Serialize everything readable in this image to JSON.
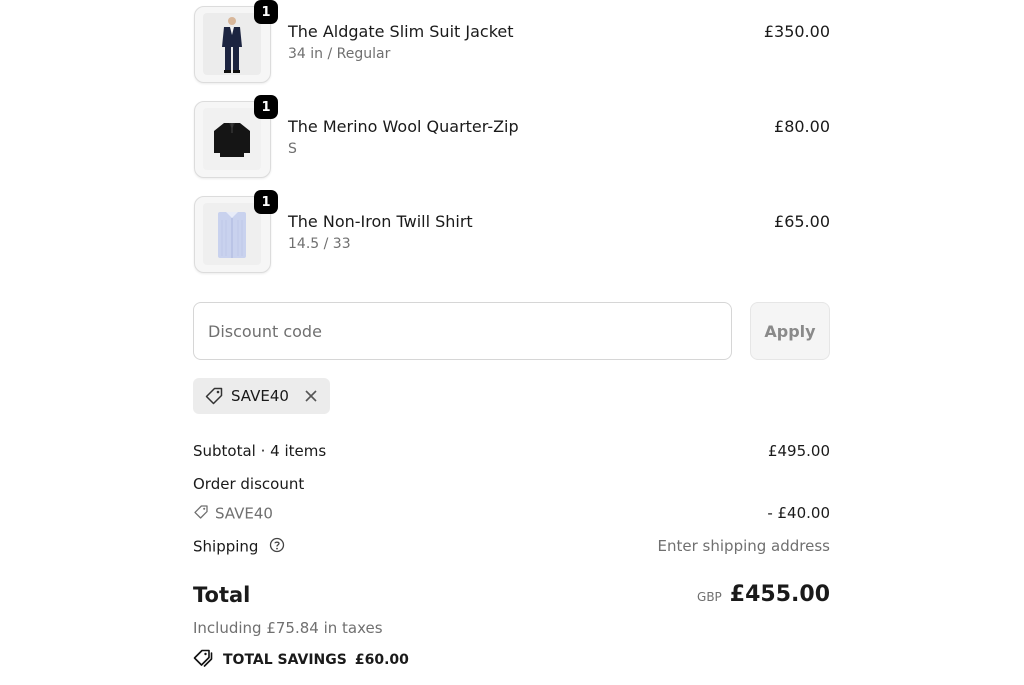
{
  "items": [
    {
      "name": "The Aldgate Slim Suit Jacket",
      "variant": "34 in / Regular",
      "price": "£350.00",
      "qty": "1"
    },
    {
      "name": "The Merino Wool Quarter-Zip",
      "variant": "S",
      "price": "£80.00",
      "qty": "1"
    },
    {
      "name": "The Non-Iron Twill Shirt",
      "variant": "14.5 / 33",
      "price": "£65.00",
      "qty": "1"
    }
  ],
  "discount": {
    "placeholder": "Discount code",
    "value": "",
    "apply_label": "Apply",
    "applied_code": "SAVE40"
  },
  "summary": {
    "subtotal_label": "Subtotal · 4 items",
    "subtotal_value": "£495.00",
    "order_discount_label": "Order discount",
    "discount_code": "SAVE40",
    "discount_value": "- £40.00",
    "shipping_label": "Shipping",
    "shipping_value": "Enter shipping address",
    "total_label": "Total",
    "currency": "GBP",
    "total_value": "£455.00",
    "taxes_text": "Including £75.84 in taxes",
    "savings_label": "TOTAL SAVINGS",
    "savings_value": "£60.00"
  },
  "icons": {
    "tag": "tag-icon",
    "close": "close-icon",
    "help": "help-circle-icon",
    "savings": "double-tag-icon"
  }
}
